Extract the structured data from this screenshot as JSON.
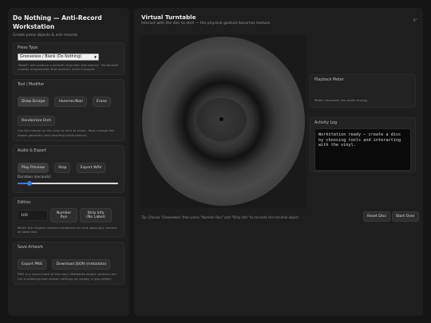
{
  "sidebar": {
    "title": "Do Nothing — Anti-Record Workstation",
    "subtitle": "Create press objects & anti-records",
    "press": {
      "heading": "Press Type",
      "selected": "Grooveless / Blank (Do Nothing)",
      "hint": "\"Blank\" will produce a smooth vinyl disc and silence. \"Scratched\" creates irregularities that produce noise if played."
    },
    "tool": {
      "heading": "Tool / Modifier",
      "buttons": [
        "Draw Scrape",
        "Hammer/Nail",
        "Erase"
      ],
      "randomize": "Randomize Etch",
      "hint": "Use the mouse on the vinyl to etch or erase. Tools change the drawn geometry and resulting audio texture."
    },
    "audio": {
      "heading": "Audio & Export",
      "play": "Play Preview",
      "stop": "Stop",
      "export_wav": "Export WAV",
      "duration_label": "Duration (seconds)",
      "duration_fraction": 0.12
    },
    "edition": {
      "heading": "Edition",
      "value": "100",
      "number_run": "Number Run",
      "strip_info": "Strip Info (No Label)",
      "hint": "Mimic the original: limited numbered run and optionally remove all label text."
    },
    "save": {
      "heading": "Save Artwork",
      "export_png": "Export PNG",
      "download_json": "Download JSON (metadata)",
      "hint": "PNG is a visual mock of the vinyl. Metadata export contains the run numbering and chosen settings (or empty, if you prefer)."
    }
  },
  "main": {
    "title": "Virtual Turntable",
    "subtitle": "Interact with the disc to etch — the physical gesture becomes texture.",
    "corner": "0°",
    "tip": "Tip: Choose \"Grooveless\" then press \"Number Run\" and \"Strip Info\" to recreate the minimal object.",
    "reset": "Reset Disc",
    "start": "Start Over",
    "meter": {
      "heading": "Playback Meter",
      "caption": "Meter visualizes live audio energy."
    },
    "log": {
      "heading": "Activity Log",
      "text": "Workstation ready — create a disc by choosing tools and interacting with the vinyl."
    }
  }
}
